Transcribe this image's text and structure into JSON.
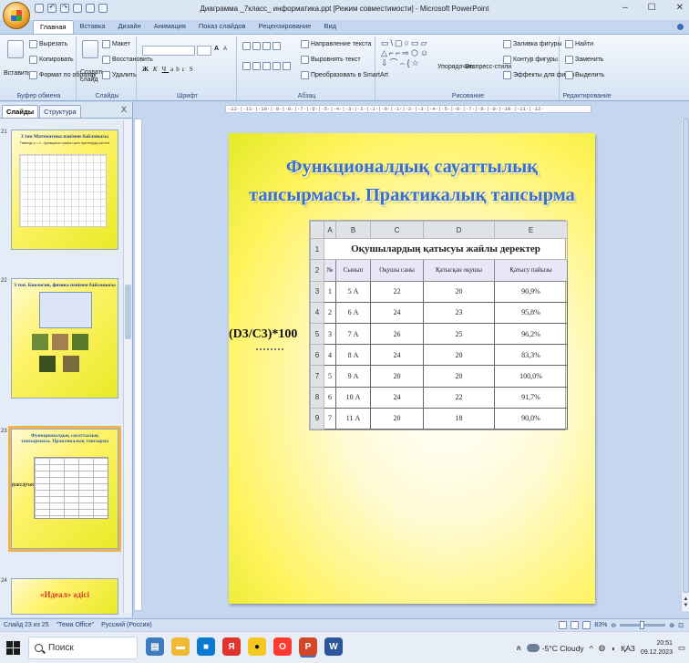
{
  "app": {
    "window_title": "Диаграмма _7класс_ информатика.ppt [Режим совместимости] - Microsoft PowerPoint",
    "window_controls": [
      "–",
      "☐",
      "✕"
    ]
  },
  "ribbon_tabs": [
    "Главная",
    "Вставка",
    "Дизайн",
    "Анимация",
    "Показ слайдов",
    "Рецензирование",
    "Вид"
  ],
  "ribbon": {
    "clipboard": {
      "paste": "Вставить",
      "cut": "Вырезать",
      "copy": "Копировать",
      "format_painter": "Формат по образцу",
      "label": "Буфер обмена"
    },
    "slides": {
      "new_slide": "Создать слайд",
      "layout": "Макет",
      "reset": "Восстановить",
      "delete": "Удалить",
      "label": "Слайды"
    },
    "font": {
      "label": "Шрифт",
      "font_size_up": "A",
      "font_size_down": "A"
    },
    "paragraph": {
      "text_direction": "Направление текста",
      "align_text": "Выровнять текст",
      "smartart": "Преобразовать в SmartArt",
      "label": "Абзац"
    },
    "drawing": {
      "arrange": "Упорядочить",
      "quick_styles": "Экспресс-стили",
      "shape_fill": "Заливка фигуры",
      "shape_outline": "Контур фигуры",
      "shape_effects": "Эффекты для фигур",
      "label": "Рисование"
    },
    "editing": {
      "find": "Найти",
      "replace": "Заменить",
      "select": "Выделить",
      "label": "Редактирование"
    }
  },
  "left_panel": {
    "tab_slides": "Слайды",
    "tab_outline": "Структура",
    "close": "X",
    "thumbnails": [
      {
        "num": "21",
        "title": "3 топ  Математика пәнімен байланысы",
        "subtitle": "Төменде y = x – функциясы графигі үшін нүктелердің кестесі"
      },
      {
        "num": "22",
        "title": "3 топ. Биология, физика пәнімен байланысы"
      },
      {
        "num": "23",
        "title": "Функционалдық сауаттылық тапсырмасы. Практикалық тапсырма",
        "formula": "(D3/C3)*100"
      },
      {
        "num": "24",
        "title": "«Идеал» әдісі"
      }
    ]
  },
  "ruler_text": "·12·|·11·|·10·|·9·|·8·|·7·|·6·|·5·|·4·|·3·|·2·|·1·|·0·|·1·|·2·|·3·|·4·|·5·|·6·|·7·|·8·|·9·|·10·|·11·|·12·",
  "slide": {
    "title_line1": "Функционалдық сауаттылық",
    "title_line2": "тапсырмасы. Практикалық тапсырма",
    "formula": "(D3/C3)*100",
    "table": {
      "columns": [
        "A",
        "B",
        "C",
        "D",
        "E"
      ],
      "title": "Оқушылардың қатысуы жайлы деректер",
      "headers": [
        "№",
        "Сынып",
        "Оқушы саны",
        "Қатысқан оқушы",
        "Қатысу пайызы"
      ],
      "rows": [
        [
          "1",
          "5 А",
          "22",
          "20",
          "90,9%"
        ],
        [
          "2",
          "6 А",
          "24",
          "23",
          "95,8%"
        ],
        [
          "3",
          "7 А",
          "26",
          "25",
          "96,2%"
        ],
        [
          "4",
          "8 А",
          "24",
          "20",
          "83,3%"
        ],
        [
          "5",
          "9 А",
          "20",
          "20",
          "100,0%"
        ],
        [
          "6",
          "10 А",
          "24",
          "22",
          "91,7%"
        ],
        [
          "7",
          "11 А",
          "20",
          "18",
          "90,0%"
        ]
      ],
      "row_numbers": [
        "1",
        "2",
        "3",
        "4",
        "5",
        "6",
        "7",
        "8",
        "9"
      ]
    }
  },
  "status": {
    "slide_info": "Слайд 23 из 25",
    "theme": "\"Тема Office\"",
    "language": "Русский (Россия)",
    "zoom": "83%"
  },
  "taskbar": {
    "search_placeholder": "Поиск",
    "weather": "-5°C Cloudy",
    "lang": "ҚАЗ",
    "time": "20:51",
    "date": "09.12.2023"
  }
}
